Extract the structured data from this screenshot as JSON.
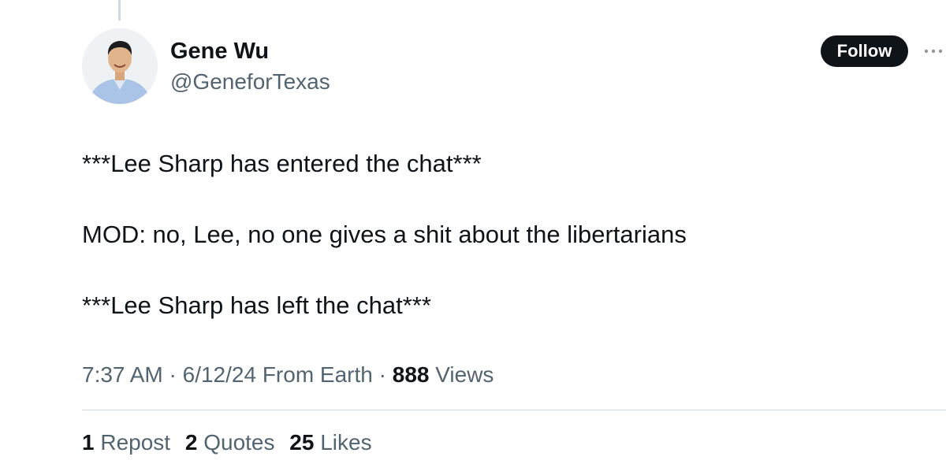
{
  "author": {
    "name": "Gene Wu",
    "handle": "@GeneforTexas"
  },
  "follow_label": "Follow",
  "tweet_lines": [
    "***Lee Sharp has entered the chat***",
    "MOD: no, Lee, no one gives a shit about the libertarians",
    "***Lee Sharp has left the chat***"
  ],
  "meta": {
    "time": "7:37 AM",
    "date": "6/12/24",
    "source": "From Earth",
    "views_count": "888",
    "views_label": "Views"
  },
  "stats": {
    "reposts_count": "1",
    "reposts_label": "Repost",
    "quotes_count": "2",
    "quotes_label": "Quotes",
    "likes_count": "25",
    "likes_label": "Likes"
  },
  "icons": {
    "more": "more-horizontal-icon",
    "avatar": "profile-photo"
  },
  "colors": {
    "text_primary": "#0f1419",
    "text_secondary": "#536471",
    "divider": "#cfd9de",
    "follow_bg": "#0f1419"
  }
}
